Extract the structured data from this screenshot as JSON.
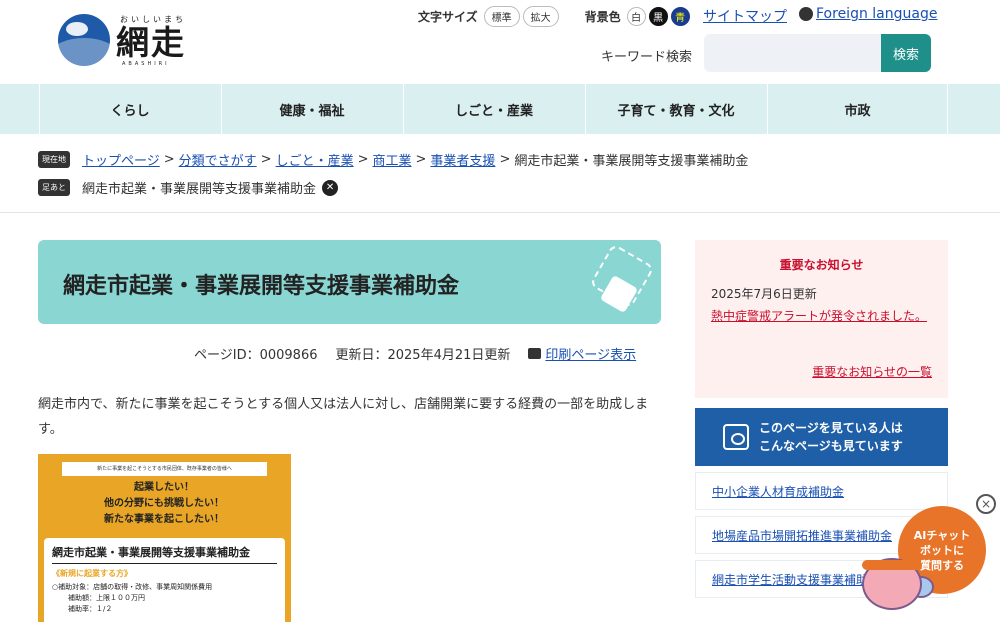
{
  "header": {
    "logo_ruby": "おいしいまち",
    "logo_text": "網走",
    "logo_sub": "ABASHIRI",
    "font_size_label": "文字サイズ",
    "font_size_options": [
      "標準",
      "拡大"
    ],
    "bg_color_label": "背景色",
    "bg_color_options": [
      "白",
      "黒",
      "青"
    ],
    "sitemap": "サイトマップ",
    "foreign": "Foreign language",
    "search_label": "キーワード検索",
    "search_placeholder": "",
    "search_button": "検索"
  },
  "nav": [
    "くらし",
    "健康・福祉",
    "しごと・産業",
    "子育て・教育・文化",
    "市政"
  ],
  "breadcrumb": {
    "tag": "現在地",
    "items": [
      "トップページ",
      "分類でさがす",
      "しごと・産業",
      "商工業",
      "事業者支援"
    ],
    "current": "網走市起業・事業展開等支援事業補助金"
  },
  "footprint": {
    "tag": "足あと",
    "item": "網走市起業・事業展開等支援事業補助金"
  },
  "page": {
    "title": "網走市起業・事業展開等支援事業補助金",
    "page_id": "ページID：0009866",
    "updated": "更新日：2025年4月21日更新",
    "print": "印刷ページ表示",
    "lead": "網走市内で、新たに事業を起こそうとする個人又は法人に対し、店舗開業に要する経費の一部を助成します。"
  },
  "flyer": {
    "top": "新たに事業を起こそうとする市民団体、既存事業者の皆様へ",
    "bubble": [
      "起業したい！",
      "他の分野にも挑戦したい！",
      "新たな事業を起こしたい！"
    ],
    "card_title": "網走市起業・事業展開等支援事業補助金",
    "card_sub": "《新規に起業する方》",
    "card_lines": [
      "○補助対象：店舗の取得・改修、事業周知関係費用",
      "補助額：上限１００万円",
      "補助率：１/２"
    ]
  },
  "notice": {
    "title": "重要なお知らせ",
    "date": "2025年7月6日更新",
    "message": "熱中症警戒アラートが発令されました。",
    "all_link": "重要なお知らせの一覧"
  },
  "related": {
    "heading_line1": "このページを見ている人は",
    "heading_line2": "こんなページも見ています",
    "items": [
      "中小企業人材育成補助金",
      "地場産品市場開拓推進事業補助金",
      "網走市学生活動支援事業補助金"
    ]
  },
  "chat": {
    "label_line1": "AIチャット",
    "label_line2": "ボットに",
    "label_line3": "質問する",
    "close": "×"
  },
  "colors": {
    "accent": "#1f8f89",
    "nav_bg": "#daf0f0",
    "title_bg": "#8ad6d3",
    "notice_red": "#c8102e",
    "related_blue": "#1f5fa8",
    "chat_orange": "#e8742a"
  }
}
